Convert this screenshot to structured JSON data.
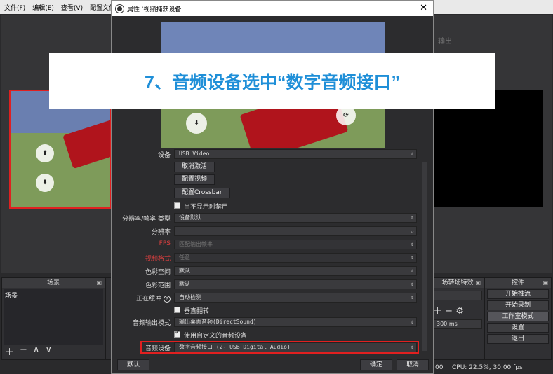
{
  "menubar": {
    "items": [
      "文件(F)",
      "编辑(E)",
      "查看(V)",
      "配置文件"
    ]
  },
  "main": {
    "right_preview_label": "输出"
  },
  "docks": {
    "scenes_title": "场景",
    "scene_items": [
      "场景"
    ],
    "transitions_title": "场转场特效",
    "transition_duration": "300 ms",
    "controls_title": "控件",
    "controls": [
      "开始推流",
      "开始录制",
      "工作室模式",
      "设置",
      "退出"
    ]
  },
  "status": {
    "cpu": "CPU: 22.5%, 30.00 fps",
    "partial": "00"
  },
  "dialog": {
    "title": "属性 '视频捕获设备'",
    "close_glyph": "✕",
    "rows": {
      "device_label": "设备",
      "device_value": "USB Video",
      "deactivate": "取消激活",
      "config_video": "配置视频",
      "config_crossbar": "配置Crossbar",
      "hide_when_inactive": "当不显示时禁用",
      "res_type_label": "分辨率/帧率 类型",
      "res_type_value": "设备默认",
      "resolution_label": "分辨率",
      "resolution_value": "",
      "fps_label": "FPS",
      "fps_value": "匹配输出帧率",
      "video_format_label": "视频格式",
      "video_format_value": "任意",
      "color_space_label": "色彩空间",
      "color_space_value": "默认",
      "color_range_label": "色彩范围",
      "color_range_value": "默认",
      "buffering_label": "正在缓冲",
      "buffering_value": "自动检测",
      "flip_vertical": "垂直翻转",
      "audio_output_label": "音频输出模式",
      "audio_output_value": "输出桌面音频(DirectSound)",
      "custom_audio": "使用自定义的音频设备",
      "audio_device_label": "音频设备",
      "audio_device_value": "数字音频接口 (2- USB Digital Audio)"
    },
    "footer": {
      "defaults": "默认",
      "ok": "确定",
      "cancel": "取消"
    }
  },
  "banner": {
    "text": "7、音频设备选中“数字音频接口”"
  },
  "colors": {
    "accent": "#1f8fd8",
    "highlight": "#e02020",
    "obs_bg": "#2a2a2c"
  }
}
